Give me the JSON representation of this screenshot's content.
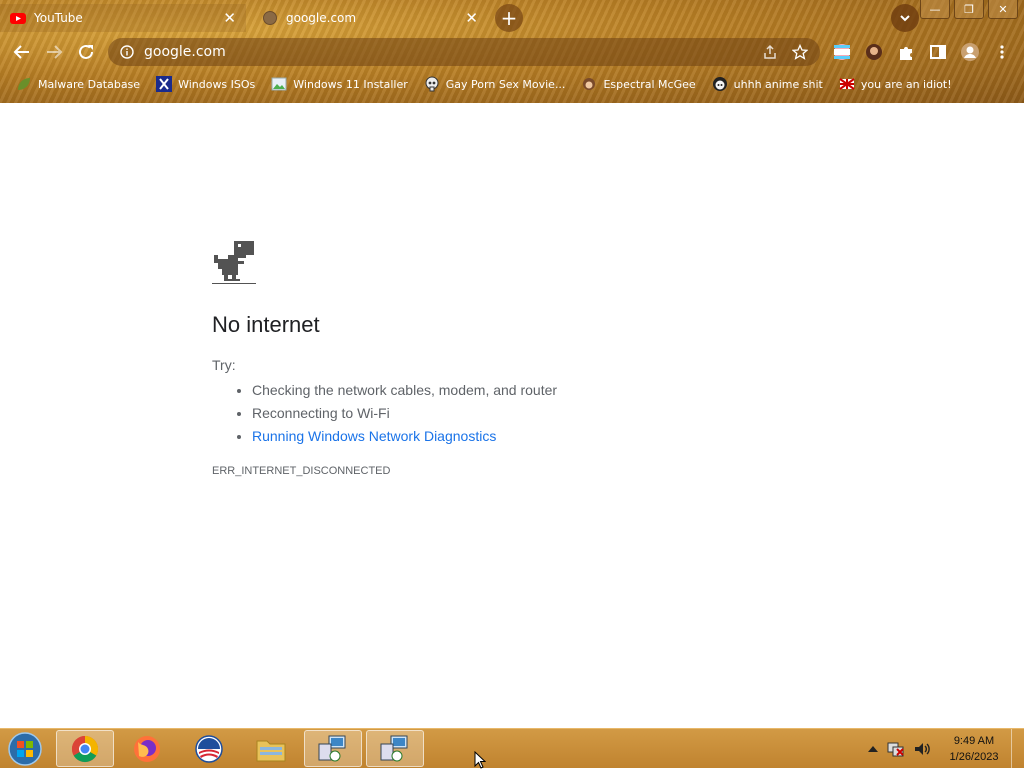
{
  "tabs": [
    {
      "title": "YouTube",
      "active": true
    },
    {
      "title": "google.com",
      "active": false
    }
  ],
  "omnibox": {
    "url": "google.com"
  },
  "bookmarks": [
    {
      "label": "Malware Database",
      "icon": "leaf-icon"
    },
    {
      "label": "Windows ISOs",
      "icon": "x-icon"
    },
    {
      "label": "Windows 11 Installer",
      "icon": "image-icon"
    },
    {
      "label": "Gay Porn Sex Movie...",
      "icon": "skull-icon"
    },
    {
      "label": "Espectral McGee",
      "icon": "character-icon"
    },
    {
      "label": "uhhh anime shit",
      "icon": "anime-icon"
    },
    {
      "label": "you are an idiot!",
      "icon": "flag-icon"
    }
  ],
  "error_page": {
    "title": "No internet",
    "try_label": "Try:",
    "suggestions": [
      "Checking the network cables, modem, and router",
      "Reconnecting to Wi-Fi",
      "Running Windows Network Diagnostics"
    ],
    "error_code": "ERR_INTERNET_DISCONNECTED"
  },
  "taskbar": {
    "items": [
      "chrome",
      "firefox",
      "obama",
      "file-explorer",
      "network-app-1",
      "network-app-2"
    ],
    "clock": {
      "time": "9:49 AM",
      "date": "1/26/2023"
    }
  },
  "colors": {
    "accent": "#1a73e8",
    "chrome_frame": "#b87e24",
    "taskbar": "#c98d3a"
  }
}
